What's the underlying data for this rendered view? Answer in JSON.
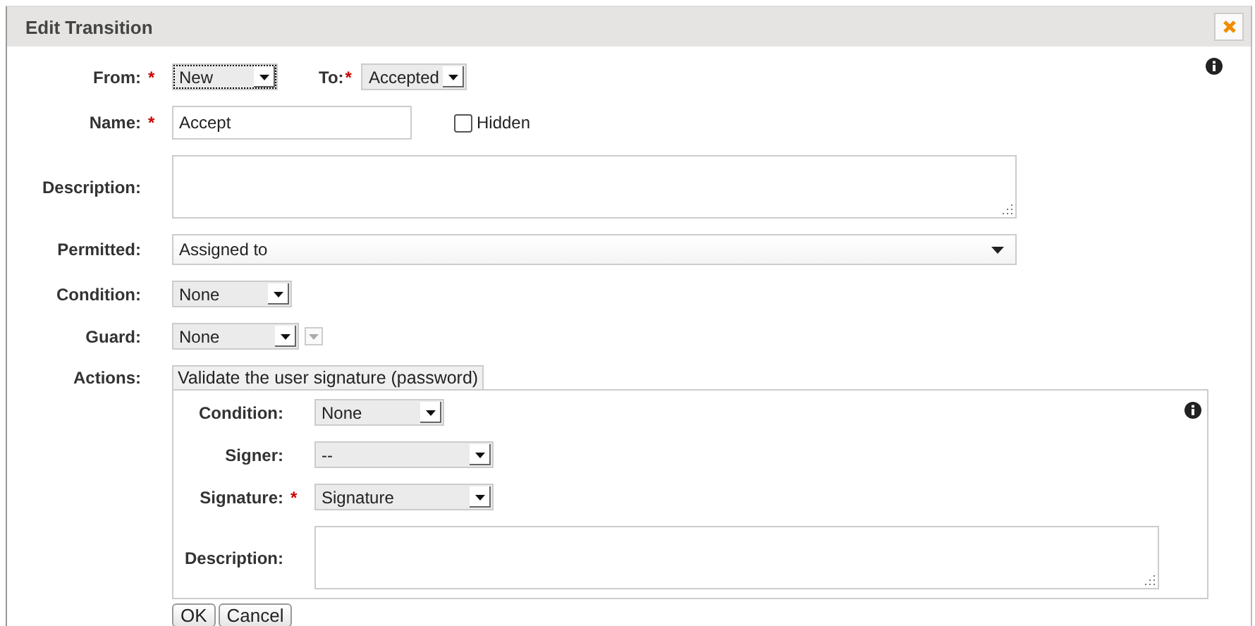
{
  "window": {
    "title": "Edit Transition"
  },
  "rows": [
    {
      "kind": "pair",
      "items": [
        {
          "label": "From:",
          "required_mark": "*",
          "value": "New",
          "focused": true
        },
        {
          "label": "To:",
          "required_mark": "*",
          "value": "Accepted",
          "focused": false
        }
      ]
    },
    {
      "kind": "text",
      "label": "Name:",
      "required_mark": "*",
      "value": "Accept",
      "checkbox": {
        "label": "Hidden",
        "checked": false
      }
    },
    {
      "kind": "textarea",
      "label": "Description:"
    },
    {
      "kind": "select",
      "label": "Permitted:",
      "value": "Assigned to",
      "focused": false
    },
    {
      "kind": "select",
      "label": "Condition:",
      "value": "None",
      "focused": false
    },
    {
      "kind": "select",
      "label": "Guard:",
      "value": "None",
      "focused": false,
      "menu_button": true
    },
    {
      "kind": "actions",
      "label": "Actions:",
      "tab": "Validate the user signature (password)",
      "rows": [
        {
          "kind": "select",
          "label": "Condition:",
          "value": "None",
          "focused": false
        },
        {
          "kind": "select",
          "label": "Signer:",
          "value": "--",
          "focused": false
        },
        {
          "kind": "select",
          "label": "Signature:",
          "required_mark": "*",
          "value": "Signature",
          "focused": false
        },
        {
          "kind": "textarea",
          "label": "Description:"
        }
      ]
    }
  ],
  "buttons": [
    "OK",
    "Cancel"
  ]
}
